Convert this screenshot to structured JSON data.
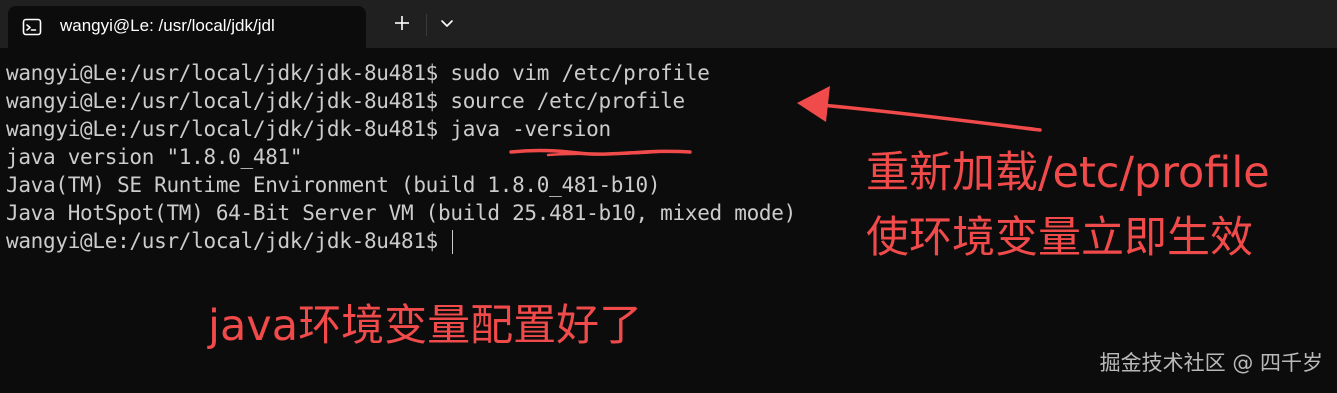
{
  "tab": {
    "icon": "terminal-icon",
    "title": "wangyi@Le: /usr/local/jdk/jdl"
  },
  "toolbar": {
    "new_tab_icon": "plus-icon",
    "dropdown_icon": "chevron-down-icon"
  },
  "terminal": {
    "lines": [
      "wangyi@Le:/usr/local/jdk/jdk-8u481$ sudo vim /etc/profile",
      "wangyi@Le:/usr/local/jdk/jdk-8u481$ source /etc/profile",
      "wangyi@Le:/usr/local/jdk/jdk-8u481$ java -version",
      "java version \"1.8.0_481\"",
      "Java(TM) SE Runtime Environment (build 1.8.0_481-b10)",
      "Java HotSpot(TM) 64-Bit Server VM (build 25.481-b10, mixed mode)",
      "wangyi@Le:/usr/local/jdk/jdk-8u481$"
    ]
  },
  "annotations": {
    "reload_line1": "重新加载/etc/profile",
    "reload_line2": "使环境变量立即生效",
    "configured": "java环境变量配置好了",
    "color": "#f04a4a",
    "arrow_icon": "arrow-icon",
    "underline_icon": "underline-scribble-icon"
  },
  "watermark": "掘金技术社区 @ 四千岁",
  "colors": {
    "background": "#0c0c0c",
    "titlebar": "#202020",
    "text": "#cccccc"
  }
}
